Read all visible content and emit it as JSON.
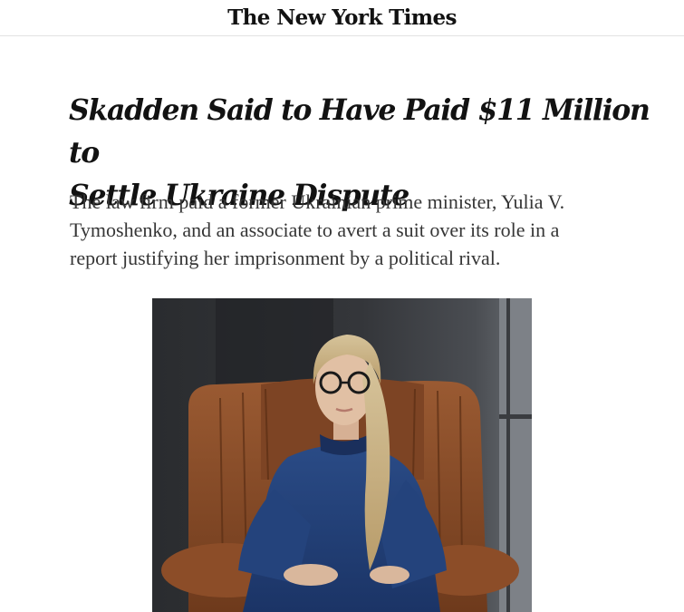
{
  "masthead": {
    "logo_text": "The New York Times"
  },
  "article": {
    "headline_line1": "Skadden Said to Have Paid $11 Million to",
    "headline_line2": "Settle Ukraine Dispute",
    "summary_line1": "The law firm paid a former Ukrainian prime minister, Yulia V.",
    "summary_line2": "Tymoshenko, and an associate to avert a suit over its role in a",
    "summary_line3": "report justifying her imprisonment by a political rival."
  },
  "colors": {
    "text_primary": "#121212",
    "text_summary": "#363636",
    "divider": "#e2e2e2",
    "photo_leather": "#8a4a26",
    "photo_jacket": "#22417a",
    "photo_hair": "#c9b48a"
  },
  "photo": {
    "subject": "woman in blue jacket seated in brown leather armchair"
  }
}
